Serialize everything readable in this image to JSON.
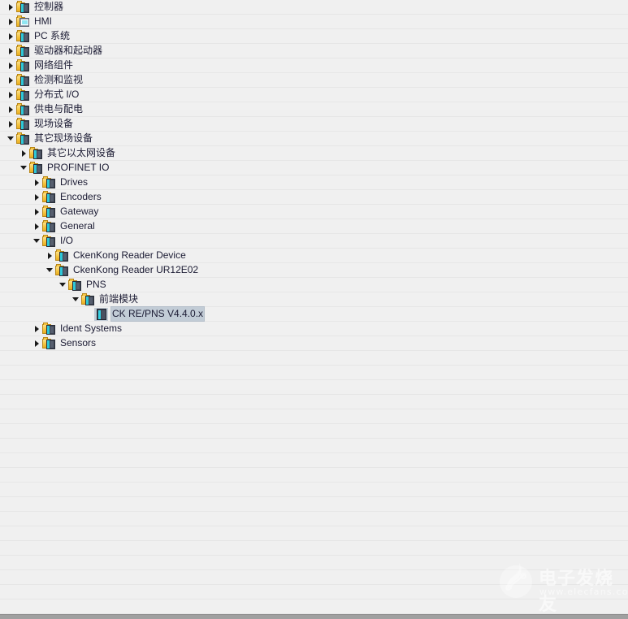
{
  "panel": {
    "name": "hardware-catalog-tree",
    "background_color": "#f0f0f0",
    "row_separator_color": "#e6e6e6",
    "text_color": "#1b1b33",
    "selection_color": "#c2ccd6"
  },
  "tree": {
    "nodes": [
      {
        "label": "控制器",
        "depth": 0,
        "state": "collapsed",
        "icon": "folder-device-icon"
      },
      {
        "label": "HMI",
        "depth": 0,
        "state": "collapsed",
        "icon": "folder-screen-icon"
      },
      {
        "label": "PC 系统",
        "depth": 0,
        "state": "collapsed",
        "icon": "folder-device-icon"
      },
      {
        "label": "驱动器和起动器",
        "depth": 0,
        "state": "collapsed",
        "icon": "folder-device-icon"
      },
      {
        "label": "网络组件",
        "depth": 0,
        "state": "collapsed",
        "icon": "folder-device-icon"
      },
      {
        "label": "检测和监视",
        "depth": 0,
        "state": "collapsed",
        "icon": "folder-device-icon"
      },
      {
        "label": "分布式 I/O",
        "depth": 0,
        "state": "collapsed",
        "icon": "folder-device-icon"
      },
      {
        "label": "供电与配电",
        "depth": 0,
        "state": "collapsed",
        "icon": "folder-device-icon"
      },
      {
        "label": "现场设备",
        "depth": 0,
        "state": "collapsed",
        "icon": "folder-device-icon"
      },
      {
        "label": "其它现场设备",
        "depth": 0,
        "state": "expanded",
        "icon": "folder-device-icon"
      },
      {
        "label": "其它以太网设备",
        "depth": 1,
        "state": "collapsed",
        "icon": "folder-device-icon"
      },
      {
        "label": "PROFINET IO",
        "depth": 1,
        "state": "expanded",
        "icon": "folder-device-icon"
      },
      {
        "label": "Drives",
        "depth": 2,
        "state": "collapsed",
        "icon": "folder-device-icon"
      },
      {
        "label": "Encoders",
        "depth": 2,
        "state": "collapsed",
        "icon": "folder-device-icon"
      },
      {
        "label": "Gateway",
        "depth": 2,
        "state": "collapsed",
        "icon": "folder-device-icon"
      },
      {
        "label": "General",
        "depth": 2,
        "state": "collapsed",
        "icon": "folder-device-icon"
      },
      {
        "label": "I/O",
        "depth": 2,
        "state": "expanded",
        "icon": "folder-device-icon"
      },
      {
        "label": "CkenKong Reader Device",
        "depth": 3,
        "state": "collapsed",
        "icon": "folder-device-icon"
      },
      {
        "label": "CkenKong Reader UR12E02",
        "depth": 3,
        "state": "expanded",
        "icon": "folder-device-icon"
      },
      {
        "label": "PNS",
        "depth": 4,
        "state": "expanded",
        "icon": "folder-device-icon"
      },
      {
        "label": "前端模块",
        "depth": 5,
        "state": "expanded",
        "icon": "folder-device-icon"
      },
      {
        "label": "CK RE/PNS V4.4.0.x",
        "depth": 6,
        "state": "leaf",
        "icon": "module-icon",
        "selected": true
      },
      {
        "label": "Ident Systems",
        "depth": 2,
        "state": "collapsed",
        "icon": "folder-device-icon"
      },
      {
        "label": "Sensors",
        "depth": 2,
        "state": "collapsed",
        "icon": "folder-device-icon"
      }
    ],
    "empty_row_count": 16
  },
  "watermark": {
    "text": "电子发烧友",
    "url": "www.elecfans.com"
  }
}
